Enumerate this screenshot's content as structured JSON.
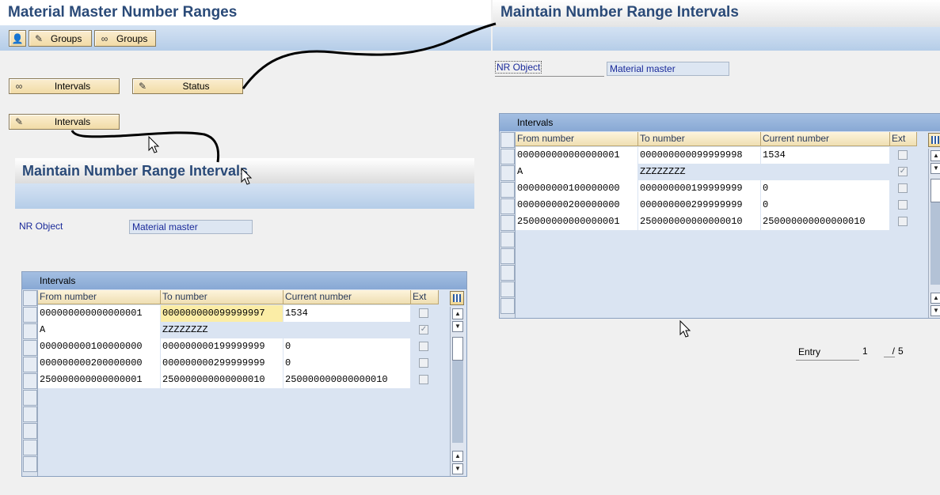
{
  "left_screen": {
    "title": "Material Master Number Ranges",
    "toolbar": {
      "groups1_label": "Groups",
      "groups2_label": "Groups"
    },
    "buttons": {
      "intervals_display": "Intervals",
      "status": "Status",
      "intervals_change": "Intervals"
    }
  },
  "right_screen": {
    "title": "Maintain Number Range Intervals",
    "nr_object_label": "NR Object",
    "nr_object_value": "Material master",
    "table": {
      "title": "Intervals",
      "columns": [
        "From number",
        "To number",
        "Current number",
        "Ext"
      ],
      "rows": [
        {
          "from": "000000000000000001",
          "to": "000000000099999998",
          "current": "1534",
          "ext": false
        },
        {
          "from": "A",
          "to": "ZZZZZZZZ",
          "current": "",
          "ext": true
        },
        {
          "from": "000000000100000000",
          "to": "000000000199999999",
          "current": "0",
          "ext": false
        },
        {
          "from": "000000000200000000",
          "to": "000000000299999999",
          "current": "0",
          "ext": false
        },
        {
          "from": "250000000000000001",
          "to": "250000000000000010",
          "current": "250000000000000010",
          "ext": false
        }
      ]
    },
    "entry_label": "Entry",
    "entry_current": "1",
    "entry_separator": "/",
    "entry_total": "5"
  },
  "inner_screen": {
    "title": "Maintain Number Range Intervals",
    "nr_object_label": "NR Object",
    "nr_object_value": "Material master",
    "table": {
      "title": "Intervals",
      "columns": [
        "From number",
        "To number",
        "Current number",
        "Ext"
      ],
      "rows": [
        {
          "from": "000000000000000001",
          "to": "000000000099999997",
          "current": "1534",
          "ext": false
        },
        {
          "from": "A",
          "to": "ZZZZZZZZ",
          "current": "",
          "ext": true
        },
        {
          "from": "000000000100000000",
          "to": "000000000199999999",
          "current": "0",
          "ext": false
        },
        {
          "from": "000000000200000000",
          "to": "000000000299999999",
          "current": "0",
          "ext": false
        },
        {
          "from": "250000000000000001",
          "to": "250000000000000010",
          "current": "250000000000000010",
          "ext": false
        }
      ]
    }
  },
  "icons": {
    "toolbar": [
      "person-icon",
      "pencil-icon",
      "glasses-icon"
    ],
    "buttons": [
      "glasses-icon",
      "pencil-icon",
      "pencil-icon"
    ]
  },
  "colors": {
    "title": "#2a4a78",
    "toolbar": "#b5cde8",
    "button": "#f1dba6",
    "field": "#dde6f2",
    "highlight": "#fbeda6"
  }
}
